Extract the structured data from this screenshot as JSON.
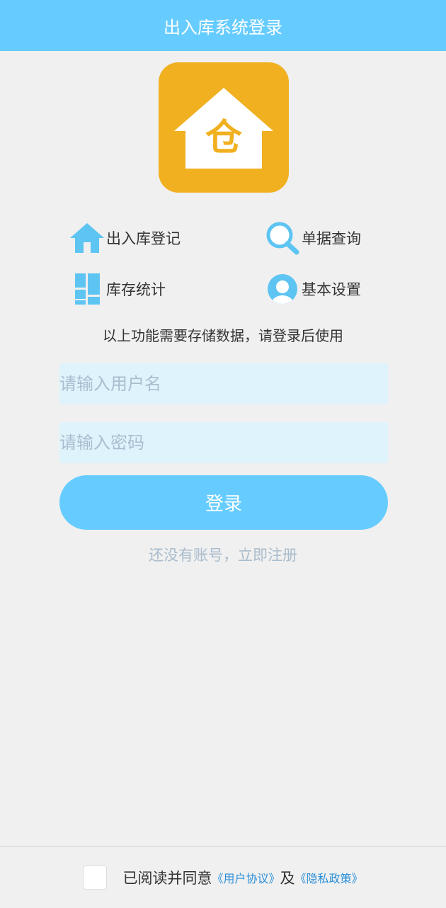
{
  "header": {
    "title": "出入库系统登录"
  },
  "logo": {
    "glyph": "仓",
    "color": "#f0b020",
    "icon": "warehouse-house-icon"
  },
  "features": [
    {
      "label": "出入库登记",
      "icon": "house-icon"
    },
    {
      "label": "单据查询",
      "icon": "search-icon"
    },
    {
      "label": "库存统计",
      "icon": "layout-blocks-icon"
    },
    {
      "label": "基本设置",
      "icon": "user-avatar-icon"
    }
  ],
  "notice": "以上功能需要存储数据，请登录后使用",
  "form": {
    "username_placeholder": "请输入用户名",
    "username_value": "",
    "password_placeholder": "请输入密码",
    "password_value": "",
    "login_label": "登录",
    "register_label": "还没有账号，立即注册"
  },
  "footer": {
    "agree_text": "已阅读并同意",
    "user_agreement": "《用户协议》",
    "and_text": "及",
    "privacy_policy": "《隐私政策》",
    "checked": false
  },
  "colors": {
    "accent": "#66ccff",
    "link": "#2a8fd8",
    "logo_bg": "#f0b020"
  }
}
